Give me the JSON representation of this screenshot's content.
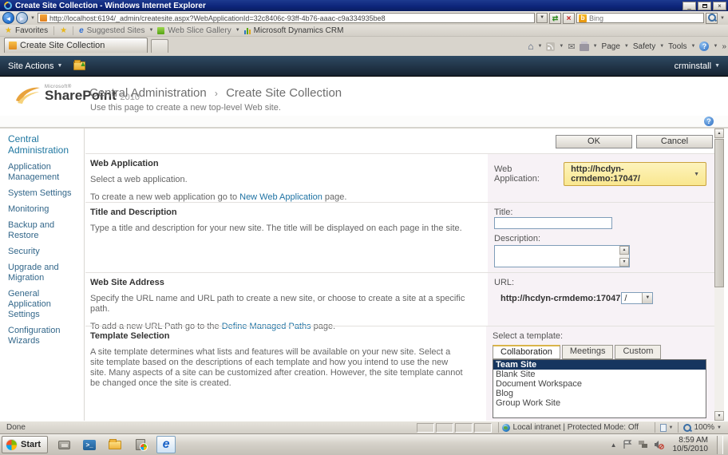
{
  "window": {
    "title": "Create Site Collection - Windows Internet Explorer"
  },
  "browser": {
    "url": "http://localhost:6194/_admin/createsite.aspx?WebApplicationId=32c8406c-93ff-4b76-aaac-c9a334935be8",
    "search_placeholder": "Bing",
    "favorites_label": "Favorites",
    "suggested_sites": "Suggested Sites",
    "web_slice_gallery": "Web Slice Gallery",
    "dynamics_crm": "Microsoft Dynamics CRM",
    "tab_title": "Create Site Collection",
    "page_label": "Page",
    "safety_label": "Safety",
    "tools_label": "Tools",
    "overflow": "»"
  },
  "site_actions": {
    "label": "Site Actions",
    "user": "crminstall"
  },
  "header": {
    "logo_microsoft": "Microsoft®",
    "logo_name": "SharePoint",
    "logo_year": "2010",
    "breadcrumb_root": "Central Administration",
    "breadcrumb_separator": "›",
    "breadcrumb_current": "Create Site Collection",
    "subtitle": "Use this page to create a new top-level Web site."
  },
  "sidebar": {
    "items": [
      "Central Administration",
      "Application Management",
      "System Settings",
      "Monitoring",
      "Backup and Restore",
      "Security",
      "Upgrade and Migration",
      "General Application Settings",
      "Configuration Wizards"
    ]
  },
  "actions": {
    "ok_label": "OK",
    "cancel_label": "Cancel"
  },
  "sections": {
    "web_application": {
      "heading": "Web Application",
      "line1": "Select a web application.",
      "line2_pre": "To create a new web application go to ",
      "line2_link": "New Web Application",
      "line2_post": " page.",
      "field_label": "Web Application:",
      "selected_value": "http://hcdyn-crmdemo:17047/"
    },
    "title_description": {
      "heading": "Title and Description",
      "line1": "Type a title and description for your new site. The title will be displayed on each page in the site.",
      "title_label": "Title:",
      "title_value": "",
      "description_label": "Description:",
      "description_value": ""
    },
    "web_site_address": {
      "heading": "Web Site Address",
      "line1": "Specify the URL name and URL path to create a new site, or choose to create a site at a specific path.",
      "line2_pre": "To add a new URL Path go to the ",
      "line2_link": "Define Managed Paths",
      "line2_post": " page.",
      "url_label": "URL:",
      "url_base": "http://hcdyn-crmdemo:17047",
      "url_path_selected": "/"
    },
    "template_selection": {
      "heading": "Template Selection",
      "line1": "A site template determines what lists and features will be available on your new site. Select a site template based on the descriptions of each template and how you intend to use the new site. Many aspects of a site can be customized after creation. However, the site template cannot be changed once the site is created.",
      "select_label": "Select a template:",
      "tabs": [
        "Collaboration",
        "Meetings",
        "Custom"
      ],
      "templates": [
        "Team Site",
        "Blank Site",
        "Document Workspace",
        "Blog",
        "Group Work Site"
      ],
      "selected_template": "Team Site"
    }
  },
  "status_bar": {
    "done": "Done",
    "zone_text": "Local intranet | Protected Mode: Off",
    "zoom_value": "100%"
  },
  "taskbar": {
    "start_label": "Start",
    "time": "8:59 AM",
    "date": "10/5/2010"
  },
  "colors": {
    "titlebar_blue": "#0C2479",
    "site_actions_navy": "#1C2C3E",
    "accent_yellow": "#F9E78F",
    "selection_blue": "#16355F",
    "link_teal": "#1E72A3"
  }
}
